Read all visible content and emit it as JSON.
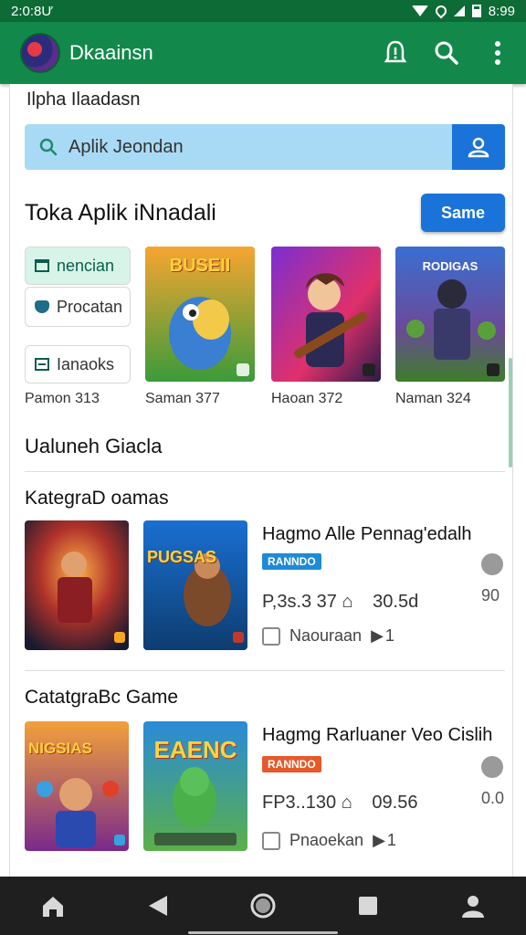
{
  "status_bar": {
    "time": "2:0:8Ư",
    "clock": "8:99"
  },
  "app_bar": {
    "title": "Dkaainsn"
  },
  "breadcrumb": "Ilpha Ilaadasn",
  "search": {
    "placeholder": "Aplik Jeondan"
  },
  "section": {
    "title": "Toka Aplik iNnadali",
    "button_label": "Same"
  },
  "chips": [
    {
      "label": "nencian",
      "icon": "calendar-icon"
    },
    {
      "label": "Procatan",
      "icon": "tag-icon"
    },
    {
      "label": "Ianaoks",
      "icon": "list-icon"
    }
  ],
  "tiles": [
    {
      "caption": "Pamon 313"
    },
    {
      "caption": "Saman 377"
    },
    {
      "caption": "Haoan 372"
    },
    {
      "caption": "Naman 324"
    }
  ],
  "tile_art": [
    {
      "label": "BUSEII"
    },
    {
      "label": ""
    },
    {
      "label": ""
    },
    {
      "label": "RODIGAS"
    }
  ],
  "heading_recent": "Ualuneh Giacla",
  "list_sections": [
    {
      "heading": "KategraD oamas",
      "thumb_labels": [
        "",
        "PUGSAS"
      ],
      "title": "Hagmo Alle Pennag'edalh",
      "badge": "RANNDO",
      "price": "P,3s.3 37",
      "price_alt": "30.5d",
      "price_side": "90",
      "meta": "Naouraan",
      "rating": "1"
    },
    {
      "heading": "CatatgraBc Game",
      "thumb_labels": [
        "NIGSIAS",
        "EAENC"
      ],
      "title": "Hagmg Rarluaner Veo Cislih",
      "badge": "RANNDO",
      "price": "FP3..130",
      "price_alt": "09.56",
      "price_side": "0.0",
      "meta": "Pnaoekan",
      "rating": "1"
    }
  ],
  "colors": {
    "app_bar": "#12894a",
    "status_bar": "#0d6b36",
    "primary_button": "#1a73d9",
    "search_bg": "#a9daf5",
    "badge_blue": "#1e8bd6",
    "badge_orange": "#e55a2a"
  }
}
